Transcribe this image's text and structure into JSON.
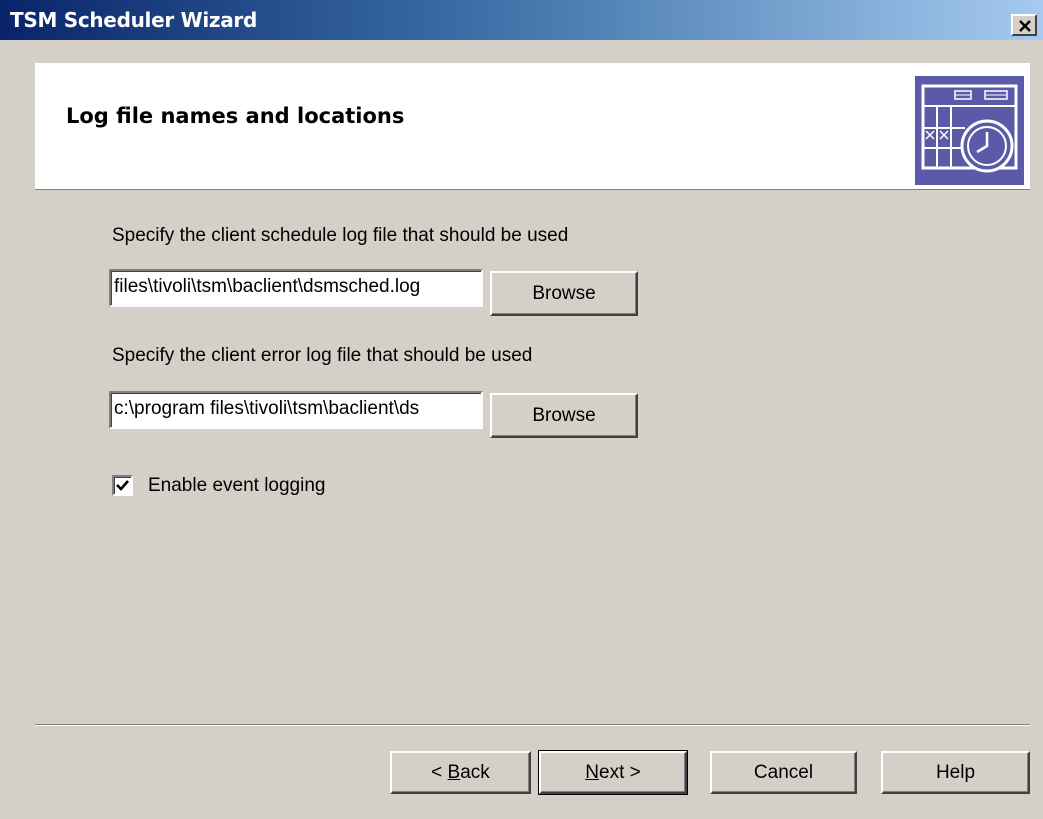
{
  "window": {
    "title": "TSM Scheduler Wizard"
  },
  "header": {
    "title": "Log file names and locations",
    "icon": "calendar-clock-icon"
  },
  "schedule_log": {
    "label": "Specify the client schedule log file that should be used",
    "value": "files\\tivoli\\tsm\\baclient\\dsmsched.log",
    "browse_label": "Browse"
  },
  "error_log": {
    "label": "Specify the client error log file that should be used",
    "value": "c:\\program files\\tivoli\\tsm\\baclient\\ds",
    "browse_label": "Browse"
  },
  "event_logging": {
    "label": "Enable event logging",
    "checked": true
  },
  "footer": {
    "back_prefix": "< ",
    "back_mnemonic": "B",
    "back_rest": "ack",
    "next_mnemonic": "N",
    "next_rest": "ext >",
    "cancel_label": "Cancel",
    "help_label": "Help"
  },
  "colors": {
    "titlebar_start": "#0a246a",
    "titlebar_end": "#a6caf0",
    "dialog_face": "#d4d0c8",
    "icon_accent": "#5a5aa8"
  }
}
